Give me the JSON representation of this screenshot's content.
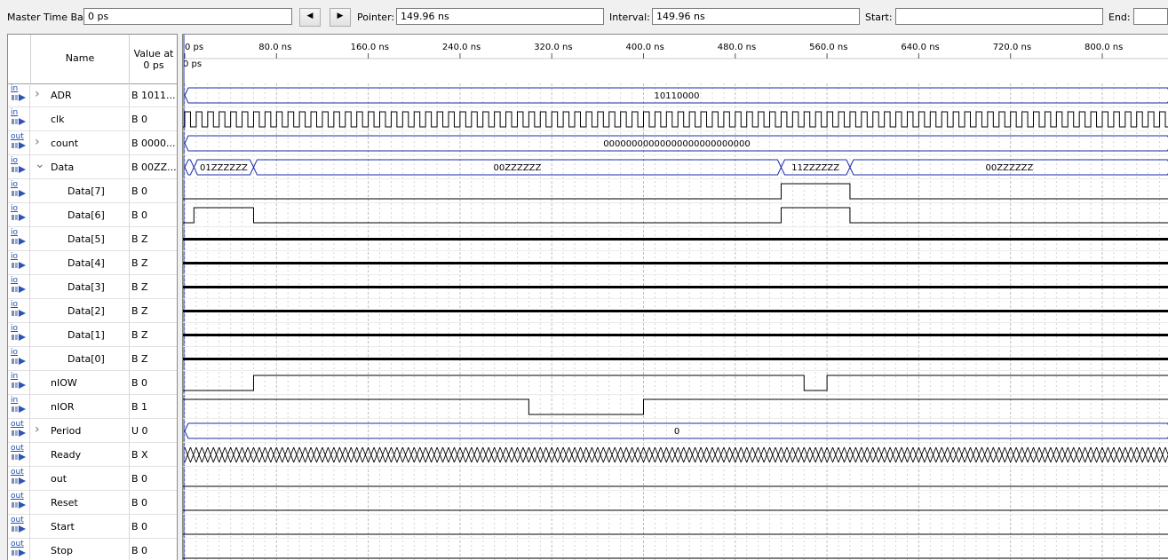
{
  "toolbar": {
    "master_time_bar_label": "Master Time Bar:",
    "master_time_bar_value": "0 ps",
    "prev_icon": "triangle-left-icon",
    "next_icon": "triangle-right-icon",
    "pointer_label": "Pointer:",
    "pointer_value": "149.96 ns",
    "interval_label": "Interval:",
    "interval_value": "149.96 ns",
    "start_label": "Start:",
    "start_value": "",
    "end_label": "End:",
    "end_value": ""
  },
  "header": {
    "name": "Name",
    "value_at_1": "Value at",
    "value_at_2": "0 ps"
  },
  "time_axis": {
    "cursor_label": "0 ps",
    "ticks": [
      "0 ps",
      "80.0 ns",
      "160.0 ns",
      "240.0 ns",
      "320.0 ns",
      "400.0 ns",
      "480.0 ns",
      "560.0 ns",
      "640.0 ns",
      "720.0 ns",
      "800.0 ns"
    ],
    "unit_ns_per_major": 80
  },
  "colors": {
    "bus": "#1a2ea6",
    "signal": "#000000",
    "grid": "#b8b8b8",
    "icon_text": "#1f4fb0"
  },
  "signals": [
    {
      "type": "in",
      "expandable": true,
      "expanded": false,
      "name": "ADR",
      "value": "B 1011...",
      "indent": 0,
      "wave": {
        "kind": "bus",
        "segments": [
          {
            "from": 0,
            "to": 860,
            "label": "10110000"
          }
        ]
      }
    },
    {
      "type": "in",
      "expandable": false,
      "name": "clk",
      "value": "B 0",
      "indent": 0,
      "wave": {
        "kind": "clock",
        "period_ns": 10
      }
    },
    {
      "type": "out",
      "expandable": true,
      "expanded": false,
      "name": "count",
      "value": "B 0000...",
      "indent": 0,
      "wave": {
        "kind": "bus",
        "segments": [
          {
            "from": 0,
            "to": 860,
            "label": "00000000000000000000000000"
          }
        ]
      }
    },
    {
      "type": "io",
      "expandable": true,
      "expanded": true,
      "name": "Data",
      "value": "B 00ZZ...",
      "indent": 0,
      "wave": {
        "kind": "bus",
        "segments": [
          {
            "from": 0,
            "to": 8,
            "label": ""
          },
          {
            "from": 8,
            "to": 60,
            "label": "01ZZZZZZ"
          },
          {
            "from": 60,
            "to": 520,
            "label": "00ZZZZZZ"
          },
          {
            "from": 520,
            "to": 580,
            "label": "11ZZZZZZ"
          },
          {
            "from": 580,
            "to": 860,
            "label": "00ZZZZZZ"
          }
        ]
      }
    },
    {
      "type": "io",
      "name": "Data[7]",
      "value": "B 0",
      "indent": 1,
      "wave": {
        "kind": "bit",
        "init": 0,
        "edges": [
          520,
          580
        ]
      }
    },
    {
      "type": "io",
      "name": "Data[6]",
      "value": "B 0",
      "indent": 1,
      "wave": {
        "kind": "bit",
        "init": 0,
        "edges": [
          8,
          60,
          520,
          580
        ]
      }
    },
    {
      "type": "io",
      "name": "Data[5]",
      "value": "B Z",
      "indent": 1,
      "wave": {
        "kind": "z"
      }
    },
    {
      "type": "io",
      "name": "Data[4]",
      "value": "B Z",
      "indent": 1,
      "wave": {
        "kind": "z"
      }
    },
    {
      "type": "io",
      "name": "Data[3]",
      "value": "B Z",
      "indent": 1,
      "wave": {
        "kind": "z"
      }
    },
    {
      "type": "io",
      "name": "Data[2]",
      "value": "B Z",
      "indent": 1,
      "wave": {
        "kind": "z"
      }
    },
    {
      "type": "io",
      "name": "Data[1]",
      "value": "B Z",
      "indent": 1,
      "wave": {
        "kind": "z"
      }
    },
    {
      "type": "io",
      "name": "Data[0]",
      "value": "B Z",
      "indent": 1,
      "wave": {
        "kind": "z"
      }
    },
    {
      "type": "in",
      "expandable": false,
      "name": "nIOW",
      "value": "B 0",
      "indent": 0,
      "wave": {
        "kind": "bit",
        "init": 0,
        "edges": [
          60,
          540,
          560
        ]
      }
    },
    {
      "type": "in",
      "expandable": false,
      "name": "nIOR",
      "value": "B 1",
      "indent": 0,
      "wave": {
        "kind": "bit",
        "init": 1,
        "edges": [
          300,
          400
        ]
      }
    },
    {
      "type": "out",
      "expandable": true,
      "expanded": false,
      "name": "Period",
      "value": "U 0",
      "indent": 0,
      "wave": {
        "kind": "bus",
        "segments": [
          {
            "from": 0,
            "to": 860,
            "label": "0"
          }
        ]
      }
    },
    {
      "type": "out",
      "expandable": false,
      "name": "Ready",
      "value": "B X",
      "indent": 0,
      "wave": {
        "kind": "x"
      }
    },
    {
      "type": "out",
      "expandable": false,
      "name": "out",
      "value": "B 0",
      "indent": 0,
      "wave": {
        "kind": "bit",
        "init": 0,
        "edges": []
      }
    },
    {
      "type": "out",
      "expandable": false,
      "name": "Reset",
      "value": "B 0",
      "indent": 0,
      "wave": {
        "kind": "bit",
        "init": 0,
        "edges": []
      }
    },
    {
      "type": "out",
      "expandable": false,
      "name": "Start",
      "value": "B 0",
      "indent": 0,
      "wave": {
        "kind": "bit",
        "init": 0,
        "edges": []
      }
    },
    {
      "type": "out",
      "expandable": false,
      "name": "Stop",
      "value": "B 0",
      "indent": 0,
      "wave": {
        "kind": "bit",
        "init": 0,
        "edges": []
      }
    }
  ]
}
